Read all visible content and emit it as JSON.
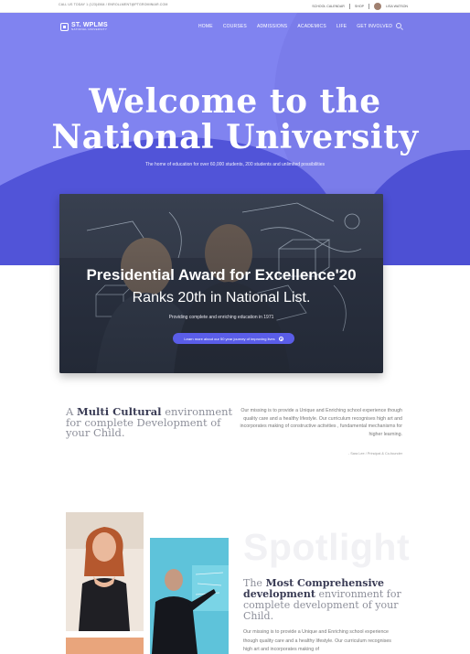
{
  "topbar": {
    "contact": "CALL US TODAY 1 (123)4564 / ENROLLMENT@PTGROMINIAR.COM",
    "links": [
      "SCHOOL CALENDAR",
      "SHOP"
    ],
    "user_name": "LISA WATSON"
  },
  "logo": {
    "name": "ST. WPLMS",
    "tagline": "NATIONAL UNIVERSITY"
  },
  "nav": {
    "items": [
      "HOME",
      "COURSES",
      "ADMISSIONS",
      "ACADEMICS",
      "LIFE",
      "GET INVOLVED"
    ]
  },
  "hero": {
    "title_line1": "Welcome to the",
    "title_line2": "National University",
    "subtitle": "The home of education for over 60,000 students, 200 students and unlimited possibilities"
  },
  "feature": {
    "title": "Presidential Award for Excellence'20",
    "subtitle": "Ranks 20th in National List.",
    "text": "Providing complete and enriching education in 1971",
    "button_label": "Learn more about our 50 year journey of improving lives"
  },
  "multicultural": {
    "heading_pre": "A ",
    "heading_bold": "Multi Cultural",
    "heading_post": " environment for complete Development of your Child.",
    "body": "Our missing is to provide a Unique and Enriching school experience though quality care and a healthy lifestyle. Our curriculum recognises high art and incorporates making of constructive activities , fundamental mechanisms for higher learning.",
    "signature": "- Sara Lee / Principal & Co-founder"
  },
  "spotlight": {
    "watermark": "Spotlight",
    "heading_pre": "The ",
    "heading_bold": "Most Comprehensive development",
    "heading_post": " environment for complete development of your Child.",
    "body": "Our missing is to provide a Unique and Enriching school experience though quality care and a healthy lifestyle. Our curriculum recognises high art and incorporates making of"
  },
  "colors": {
    "brand": "#8083f0",
    "accent": "#5a5de8",
    "dark_blue": "#4d50d4"
  }
}
